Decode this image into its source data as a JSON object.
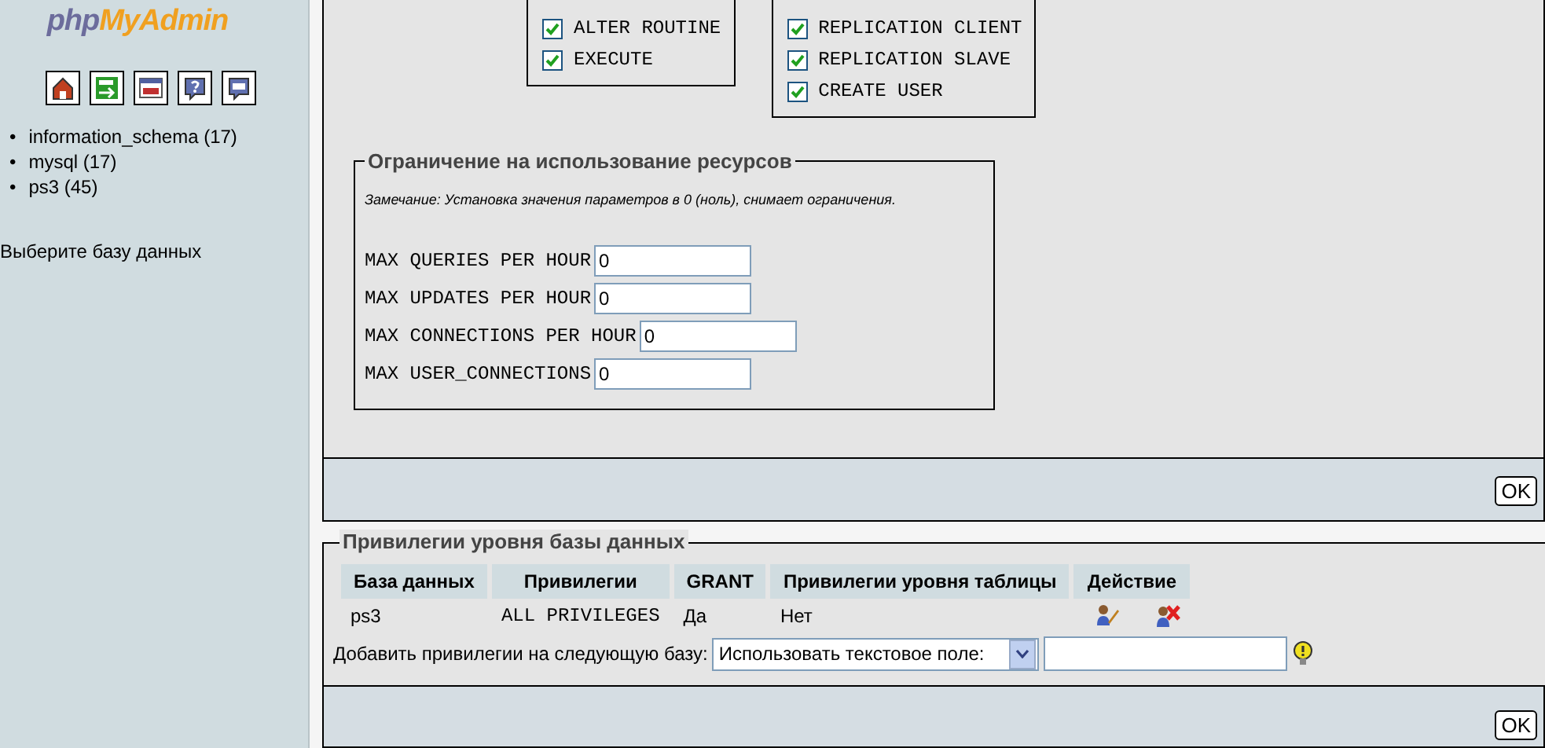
{
  "sidebar": {
    "logo": {
      "part_1": "php",
      "part_2": "MyAdmin"
    },
    "databases": [
      {
        "marker": "•",
        "name": "information_schema (17)"
      },
      {
        "marker": "•",
        "name": "mysql (17)"
      },
      {
        "marker": "•",
        "name": "ps3 (45)"
      }
    ],
    "hint": "Выберите базу данных"
  },
  "privilege_groups": [
    {
      "items": [
        {
          "label": "ALTER ROUTINE",
          "checked": true
        },
        {
          "label": "EXECUTE",
          "checked": true
        }
      ]
    },
    {
      "items": [
        {
          "label": "REPLICATION CLIENT",
          "checked": true
        },
        {
          "label": "REPLICATION SLAVE",
          "checked": true
        },
        {
          "label": "CREATE USER",
          "checked": true
        }
      ]
    }
  ],
  "resource_limits": {
    "legend": "Ограничение на использование ресурсов",
    "note": "Замечание: Установка значения параметров в 0 (ноль), снимает ограничения.",
    "fields": [
      {
        "label": "MAX QUERIES PER HOUR",
        "value": "0"
      },
      {
        "label": "MAX UPDATES PER HOUR",
        "value": "0"
      },
      {
        "label": "MAX CONNECTIONS PER HOUR",
        "value": "0"
      },
      {
        "label": "MAX USER_CONNECTIONS",
        "value": "0"
      }
    ]
  },
  "global_footer": {
    "button": "OK"
  },
  "db_privileges": {
    "legend": "Привилегии уровня базы данных",
    "columns": [
      "База данных",
      "Привилегии",
      "GRANT",
      "Привилегии уровня таблицы",
      "Действие"
    ],
    "rows": [
      {
        "cells": [
          "ps3",
          "ALL PRIVILEGES",
          "Да",
          "Нет"
        ]
      }
    ],
    "add_label": "Добавить привилегии на следующую базу:",
    "select_value": "Использовать текстовое поле:",
    "footer_button": "OK"
  }
}
